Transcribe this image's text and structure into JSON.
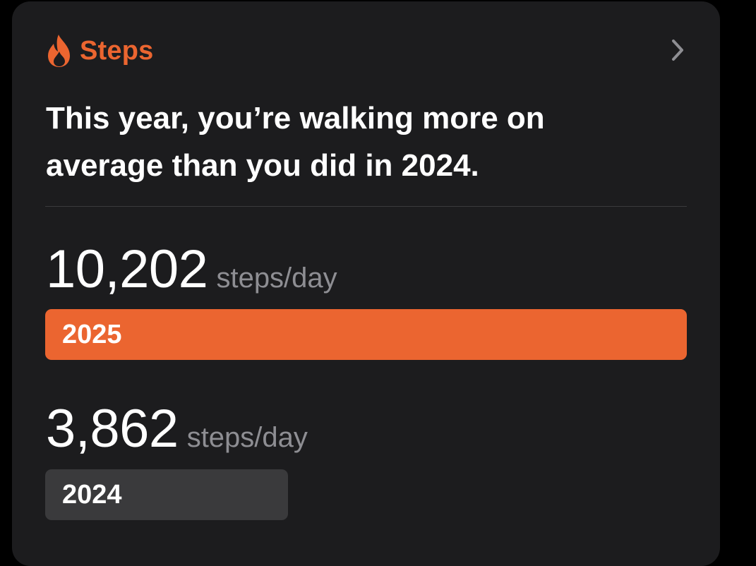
{
  "card": {
    "category": "Steps",
    "icon": "flame-icon",
    "accent_color": "#eb6530",
    "headline": "This year, you’re walking more on average than you did in 2024."
  },
  "comparison": [
    {
      "value": "10,202",
      "unit": "steps/day",
      "year": "2025",
      "bar_color": "#eb6530",
      "bar_fraction": 1.0
    },
    {
      "value": "3,862",
      "unit": "steps/day",
      "year": "2024",
      "bar_color": "#3a3a3c",
      "bar_fraction": 0.378
    }
  ]
}
